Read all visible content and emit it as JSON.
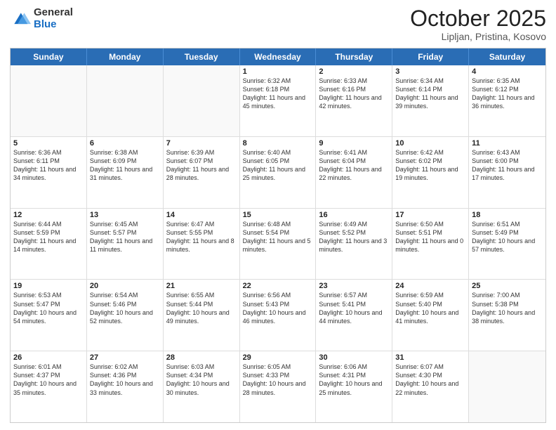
{
  "header": {
    "logo_general": "General",
    "logo_blue": "Blue",
    "title": "October 2025",
    "location": "Lipljan, Pristina, Kosovo"
  },
  "days_of_week": [
    "Sunday",
    "Monday",
    "Tuesday",
    "Wednesday",
    "Thursday",
    "Friday",
    "Saturday"
  ],
  "weeks": [
    [
      {
        "day": "",
        "sunrise": "",
        "sunset": "",
        "daylight": "",
        "empty": true
      },
      {
        "day": "",
        "sunrise": "",
        "sunset": "",
        "daylight": "",
        "empty": true
      },
      {
        "day": "",
        "sunrise": "",
        "sunset": "",
        "daylight": "",
        "empty": true
      },
      {
        "day": "1",
        "sunrise": "Sunrise: 6:32 AM",
        "sunset": "Sunset: 6:18 PM",
        "daylight": "Daylight: 11 hours and 45 minutes.",
        "empty": false
      },
      {
        "day": "2",
        "sunrise": "Sunrise: 6:33 AM",
        "sunset": "Sunset: 6:16 PM",
        "daylight": "Daylight: 11 hours and 42 minutes.",
        "empty": false
      },
      {
        "day": "3",
        "sunrise": "Sunrise: 6:34 AM",
        "sunset": "Sunset: 6:14 PM",
        "daylight": "Daylight: 11 hours and 39 minutes.",
        "empty": false
      },
      {
        "day": "4",
        "sunrise": "Sunrise: 6:35 AM",
        "sunset": "Sunset: 6:12 PM",
        "daylight": "Daylight: 11 hours and 36 minutes.",
        "empty": false
      }
    ],
    [
      {
        "day": "5",
        "sunrise": "Sunrise: 6:36 AM",
        "sunset": "Sunset: 6:11 PM",
        "daylight": "Daylight: 11 hours and 34 minutes.",
        "empty": false
      },
      {
        "day": "6",
        "sunrise": "Sunrise: 6:38 AM",
        "sunset": "Sunset: 6:09 PM",
        "daylight": "Daylight: 11 hours and 31 minutes.",
        "empty": false
      },
      {
        "day": "7",
        "sunrise": "Sunrise: 6:39 AM",
        "sunset": "Sunset: 6:07 PM",
        "daylight": "Daylight: 11 hours and 28 minutes.",
        "empty": false
      },
      {
        "day": "8",
        "sunrise": "Sunrise: 6:40 AM",
        "sunset": "Sunset: 6:05 PM",
        "daylight": "Daylight: 11 hours and 25 minutes.",
        "empty": false
      },
      {
        "day": "9",
        "sunrise": "Sunrise: 6:41 AM",
        "sunset": "Sunset: 6:04 PM",
        "daylight": "Daylight: 11 hours and 22 minutes.",
        "empty": false
      },
      {
        "day": "10",
        "sunrise": "Sunrise: 6:42 AM",
        "sunset": "Sunset: 6:02 PM",
        "daylight": "Daylight: 11 hours and 19 minutes.",
        "empty": false
      },
      {
        "day": "11",
        "sunrise": "Sunrise: 6:43 AM",
        "sunset": "Sunset: 6:00 PM",
        "daylight": "Daylight: 11 hours and 17 minutes.",
        "empty": false
      }
    ],
    [
      {
        "day": "12",
        "sunrise": "Sunrise: 6:44 AM",
        "sunset": "Sunset: 5:59 PM",
        "daylight": "Daylight: 11 hours and 14 minutes.",
        "empty": false
      },
      {
        "day": "13",
        "sunrise": "Sunrise: 6:45 AM",
        "sunset": "Sunset: 5:57 PM",
        "daylight": "Daylight: 11 hours and 11 minutes.",
        "empty": false
      },
      {
        "day": "14",
        "sunrise": "Sunrise: 6:47 AM",
        "sunset": "Sunset: 5:55 PM",
        "daylight": "Daylight: 11 hours and 8 minutes.",
        "empty": false
      },
      {
        "day": "15",
        "sunrise": "Sunrise: 6:48 AM",
        "sunset": "Sunset: 5:54 PM",
        "daylight": "Daylight: 11 hours and 5 minutes.",
        "empty": false
      },
      {
        "day": "16",
        "sunrise": "Sunrise: 6:49 AM",
        "sunset": "Sunset: 5:52 PM",
        "daylight": "Daylight: 11 hours and 3 minutes.",
        "empty": false
      },
      {
        "day": "17",
        "sunrise": "Sunrise: 6:50 AM",
        "sunset": "Sunset: 5:51 PM",
        "daylight": "Daylight: 11 hours and 0 minutes.",
        "empty": false
      },
      {
        "day": "18",
        "sunrise": "Sunrise: 6:51 AM",
        "sunset": "Sunset: 5:49 PM",
        "daylight": "Daylight: 10 hours and 57 minutes.",
        "empty": false
      }
    ],
    [
      {
        "day": "19",
        "sunrise": "Sunrise: 6:53 AM",
        "sunset": "Sunset: 5:47 PM",
        "daylight": "Daylight: 10 hours and 54 minutes.",
        "empty": false
      },
      {
        "day": "20",
        "sunrise": "Sunrise: 6:54 AM",
        "sunset": "Sunset: 5:46 PM",
        "daylight": "Daylight: 10 hours and 52 minutes.",
        "empty": false
      },
      {
        "day": "21",
        "sunrise": "Sunrise: 6:55 AM",
        "sunset": "Sunset: 5:44 PM",
        "daylight": "Daylight: 10 hours and 49 minutes.",
        "empty": false
      },
      {
        "day": "22",
        "sunrise": "Sunrise: 6:56 AM",
        "sunset": "Sunset: 5:43 PM",
        "daylight": "Daylight: 10 hours and 46 minutes.",
        "empty": false
      },
      {
        "day": "23",
        "sunrise": "Sunrise: 6:57 AM",
        "sunset": "Sunset: 5:41 PM",
        "daylight": "Daylight: 10 hours and 44 minutes.",
        "empty": false
      },
      {
        "day": "24",
        "sunrise": "Sunrise: 6:59 AM",
        "sunset": "Sunset: 5:40 PM",
        "daylight": "Daylight: 10 hours and 41 minutes.",
        "empty": false
      },
      {
        "day": "25",
        "sunrise": "Sunrise: 7:00 AM",
        "sunset": "Sunset: 5:38 PM",
        "daylight": "Daylight: 10 hours and 38 minutes.",
        "empty": false
      }
    ],
    [
      {
        "day": "26",
        "sunrise": "Sunrise: 6:01 AM",
        "sunset": "Sunset: 4:37 PM",
        "daylight": "Daylight: 10 hours and 35 minutes.",
        "empty": false
      },
      {
        "day": "27",
        "sunrise": "Sunrise: 6:02 AM",
        "sunset": "Sunset: 4:36 PM",
        "daylight": "Daylight: 10 hours and 33 minutes.",
        "empty": false
      },
      {
        "day": "28",
        "sunrise": "Sunrise: 6:03 AM",
        "sunset": "Sunset: 4:34 PM",
        "daylight": "Daylight: 10 hours and 30 minutes.",
        "empty": false
      },
      {
        "day": "29",
        "sunrise": "Sunrise: 6:05 AM",
        "sunset": "Sunset: 4:33 PM",
        "daylight": "Daylight: 10 hours and 28 minutes.",
        "empty": false
      },
      {
        "day": "30",
        "sunrise": "Sunrise: 6:06 AM",
        "sunset": "Sunset: 4:31 PM",
        "daylight": "Daylight: 10 hours and 25 minutes.",
        "empty": false
      },
      {
        "day": "31",
        "sunrise": "Sunrise: 6:07 AM",
        "sunset": "Sunset: 4:30 PM",
        "daylight": "Daylight: 10 hours and 22 minutes.",
        "empty": false
      },
      {
        "day": "",
        "sunrise": "",
        "sunset": "",
        "daylight": "",
        "empty": true
      }
    ]
  ]
}
